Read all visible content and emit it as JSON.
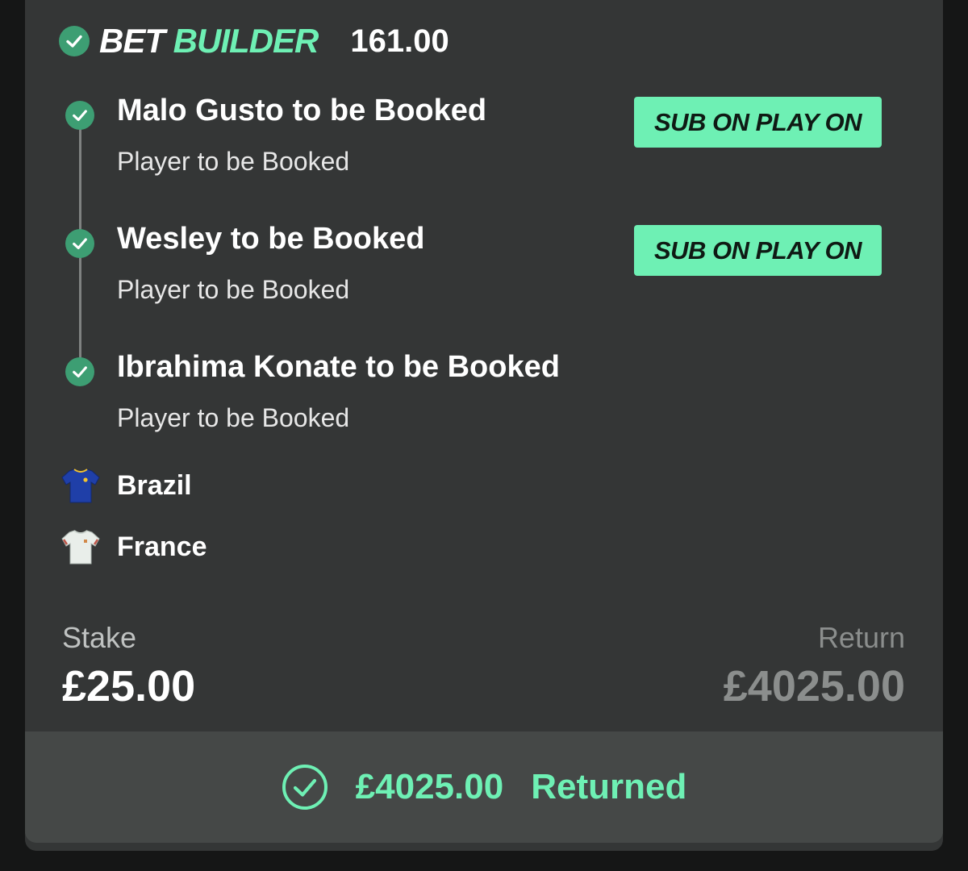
{
  "header": {
    "title_prefix": "BET",
    "title_accent": "BUILDER",
    "odds": "161.00"
  },
  "selections": [
    {
      "title": "Malo Gusto to be Booked",
      "market": "Player to be Booked",
      "badge": "SUB ON PLAY ON"
    },
    {
      "title": "Wesley to be Booked",
      "market": "Player to be Booked",
      "badge": "SUB ON PLAY ON"
    },
    {
      "title": "Ibrahima Konate to be Booked",
      "market": "Player to be Booked"
    }
  ],
  "teams": [
    {
      "name": "Brazil",
      "shirt_color": "#1f3fa8"
    },
    {
      "name": "France",
      "shirt_color": "#e9eeea"
    }
  ],
  "stake": {
    "label": "Stake",
    "value": "£25.00"
  },
  "return": {
    "label": "Return",
    "value": "£4025.00"
  },
  "result": {
    "amount": "£4025.00",
    "status": "Returned"
  },
  "colors": {
    "accent": "#6ef0b4",
    "check": "#3d9e73",
    "card": "#343636",
    "footer": "#454847",
    "background": "#151616"
  },
  "icons": {
    "header": "check-circle-icon",
    "selection": "check-circle-icon",
    "team": "shirt-icon",
    "result": "check-ring-icon"
  }
}
